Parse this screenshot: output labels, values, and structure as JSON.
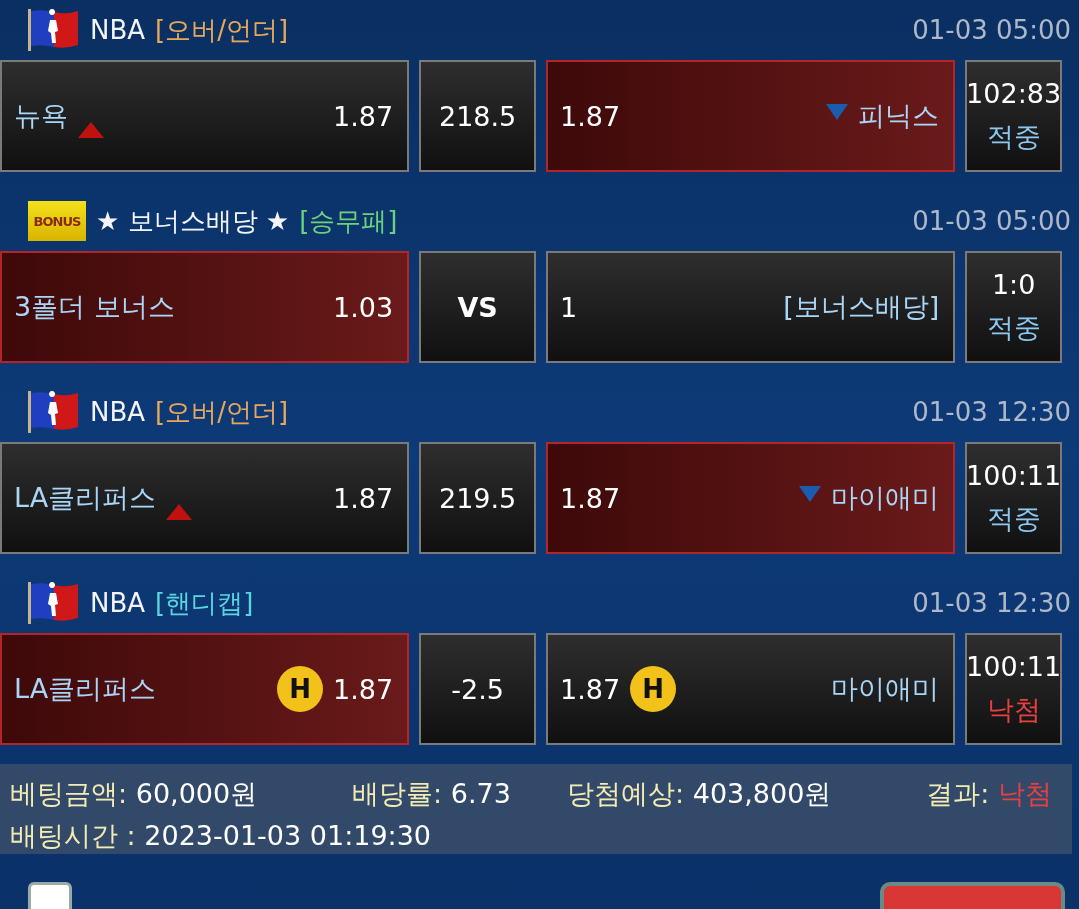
{
  "games": [
    {
      "kind": "nba",
      "league": "NBA",
      "tag": {
        "label": "[오버/언더]",
        "color": "#e8a85a"
      },
      "time": "01-03 05:00",
      "cells": [
        {
          "kind": "over",
          "name": "뉴욕",
          "odds": "1.87",
          "selected": false
        },
        {
          "kind": "line",
          "value": "218.5"
        },
        {
          "kind": "under",
          "name": "피닉스",
          "odds": "1.87",
          "selected": true
        }
      ],
      "result": {
        "score": "102:83",
        "status": "적중",
        "won": true
      }
    },
    {
      "kind": "bonus",
      "badge": "BONUS",
      "league": "★ 보너스배당 ★",
      "tag": {
        "label": "[승무패]",
        "color": "#6cd27a"
      },
      "time": "01-03 05:00",
      "cells": [
        {
          "kind": "plain",
          "name": "3폴더 보너스",
          "odds": "1.03",
          "selected": true
        },
        {
          "kind": "vs",
          "value": "VS"
        },
        {
          "kind": "plain",
          "name": "[보너스배당]",
          "odds": "1",
          "selected": false
        }
      ],
      "result": {
        "score": "1:0",
        "status": "적중",
        "won": true
      }
    },
    {
      "kind": "nba",
      "league": "NBA",
      "tag": {
        "label": "[오버/언더]",
        "color": "#e8a85a"
      },
      "time": "01-03 12:30",
      "cells": [
        {
          "kind": "over",
          "name": "LA클리퍼스",
          "odds": "1.87",
          "selected": false
        },
        {
          "kind": "line",
          "value": "219.5"
        },
        {
          "kind": "under",
          "name": "마이애미",
          "odds": "1.87",
          "selected": true
        }
      ],
      "result": {
        "score": "100:11",
        "status": "적중",
        "won": true
      }
    },
    {
      "kind": "nba",
      "league": "NBA",
      "tag": {
        "label": "[핸디캡]",
        "color": "#5cd4e0"
      },
      "time": "01-03 12:30",
      "cells": [
        {
          "kind": "handicap",
          "badge": "H",
          "name": "LA클리퍼스",
          "odds": "1.87",
          "selected": true
        },
        {
          "kind": "line",
          "value": "-2.5"
        },
        {
          "kind": "handicap",
          "badge": "H",
          "name": "마이애미",
          "odds": "1.87",
          "selected": false
        }
      ],
      "result": {
        "score": "100:11",
        "status": "낙첨",
        "won": false
      }
    }
  ],
  "summary": {
    "items": [
      {
        "label": "베팅금액:",
        "value": "60,000원",
        "kind": "plain"
      },
      {
        "label": "배당률:",
        "value": "6.73",
        "kind": "plain"
      },
      {
        "label": "당첨예상:",
        "value": "403,800원",
        "kind": "plain"
      },
      {
        "label": "결과:",
        "value": "낙첨",
        "kind": "lose"
      }
    ],
    "time": {
      "label": "배팅시간 :",
      "value": "2023-01-03 01:19:30"
    }
  },
  "footer": {
    "checkbox": {
      "checked": false
    }
  }
}
